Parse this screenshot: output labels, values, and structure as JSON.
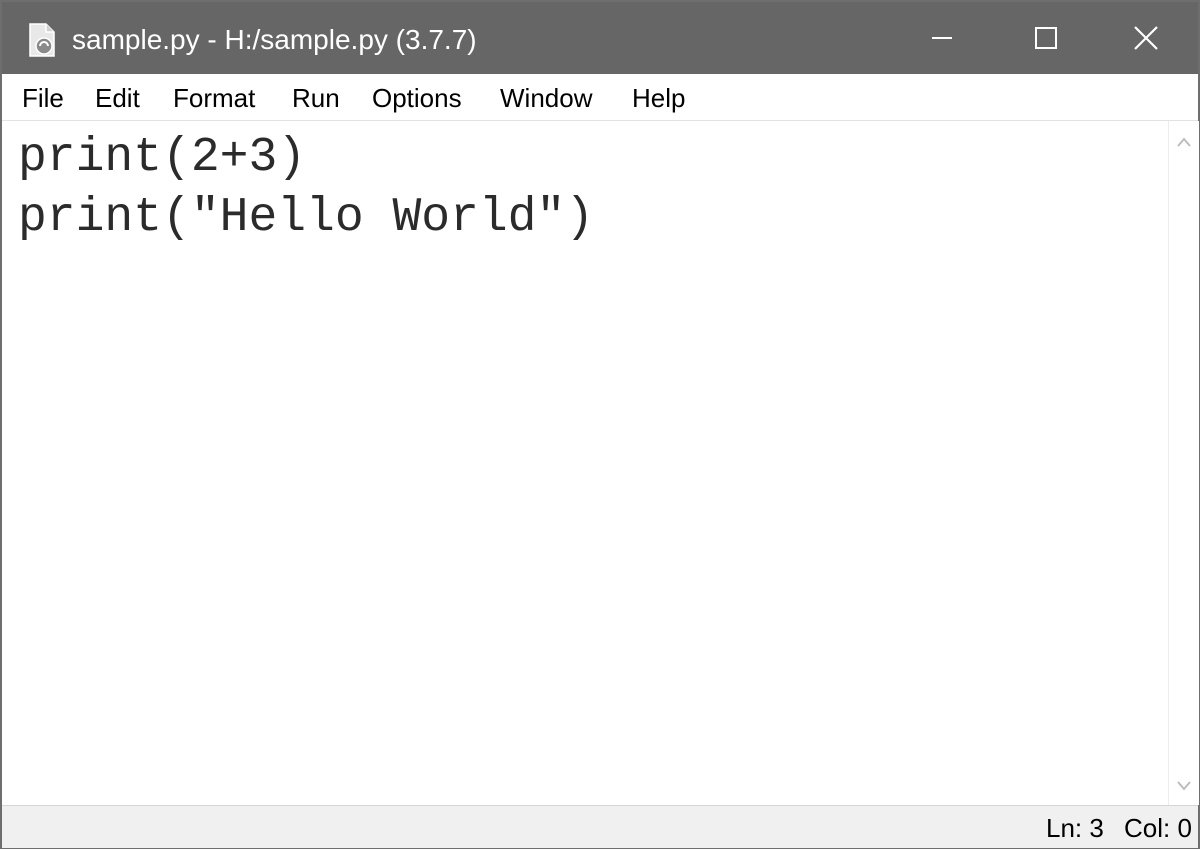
{
  "window": {
    "title": "sample.py - H:/sample.py (3.7.7)",
    "app_icon": "python-idle-icon",
    "controls": {
      "minimize_icon": "minimize-icon",
      "maximize_icon": "maximize-icon",
      "close_icon": "close-icon"
    }
  },
  "menu": {
    "items": [
      {
        "label": "File"
      },
      {
        "label": "Edit"
      },
      {
        "label": "Format"
      },
      {
        "label": "Run"
      },
      {
        "label": "Options"
      },
      {
        "label": "Window"
      },
      {
        "label": "Help"
      }
    ]
  },
  "editor": {
    "lines": [
      "print(2+3)",
      "print(\"Hello World\")"
    ]
  },
  "scrollbar": {
    "up_icon": "chevron-up-icon",
    "down_icon": "chevron-down-icon"
  },
  "status": {
    "ln": "Ln: 3",
    "col": "Col: 0"
  },
  "colors": {
    "titlebar_bg": "#666666",
    "titlebar_text": "#ffffff",
    "code_text": "#2b2b2b",
    "statusbar_bg": "#f0f0f0"
  }
}
